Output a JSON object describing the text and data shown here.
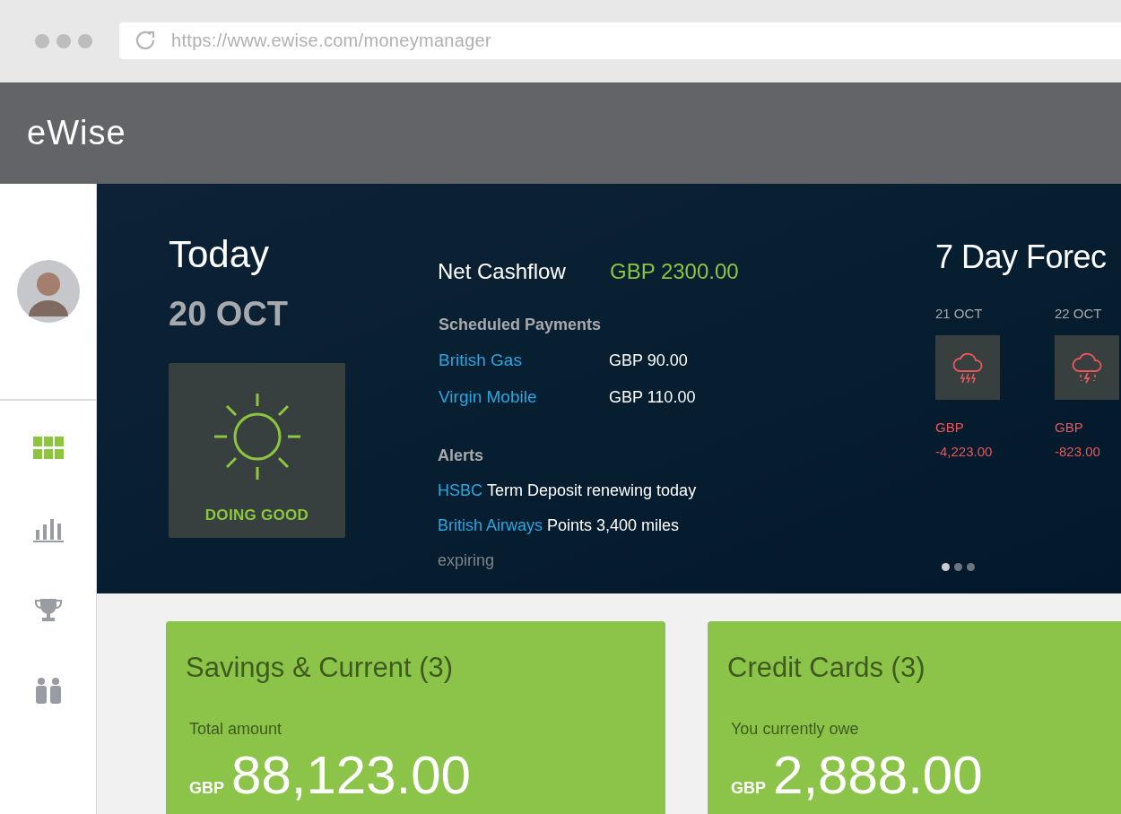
{
  "browser": {
    "url": "https://www.ewise.com/moneymanager"
  },
  "header": {
    "logo": "eWise"
  },
  "sidebar": {
    "items": [
      {
        "kind": "grid",
        "selected": true
      },
      {
        "kind": "chart",
        "selected": false
      },
      {
        "kind": "trophy",
        "selected": false
      },
      {
        "kind": "people",
        "selected": false
      }
    ]
  },
  "today": {
    "title": "Today",
    "date": "20 OCT",
    "status": "DOING GOOD"
  },
  "cashflow": {
    "label": "Net Cashflow",
    "value": "GBP 2300.00"
  },
  "scheduled_payments": {
    "title": "Scheduled Payments",
    "items": [
      {
        "payee": "British Gas",
        "amount": "GBP 90.00"
      },
      {
        "payee": "Virgin Mobile",
        "amount": "GBP 110.00"
      }
    ]
  },
  "alerts": {
    "title": "Alerts",
    "items": [
      {
        "link": "HSBC",
        "text": "Term Deposit renewing today"
      },
      {
        "link": "British Airways",
        "text": "Points 3,400 miles",
        "more": "expiring"
      }
    ]
  },
  "forecast": {
    "title": "7 Day Forec",
    "days": [
      {
        "date": "21 OCT",
        "kind": "storm-rain",
        "currency": "GBP",
        "amount": "-4,223.00"
      },
      {
        "date": "22 OCT",
        "kind": "storm-lightning",
        "currency": "GBP",
        "amount": "-823.00"
      }
    ],
    "pages": [
      {
        "selected": true
      },
      {
        "selected": false
      },
      {
        "selected": false
      }
    ]
  },
  "cards": [
    {
      "title": "Savings & Current (3)",
      "label": "Total amount",
      "currency": "GBP",
      "amount": "88,123.00"
    },
    {
      "title": "Credit Cards (3)",
      "label": "You currently owe",
      "currency": "GBP",
      "amount": "2,888.00"
    }
  ]
}
